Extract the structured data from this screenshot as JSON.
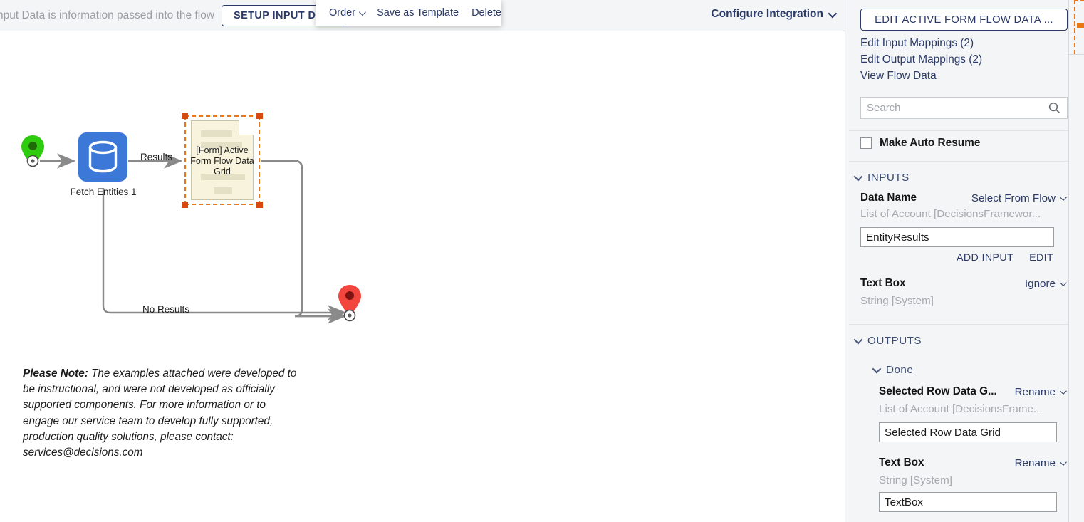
{
  "header": {
    "hint_text": "nput Data is information passed into the flow",
    "setup_input_label": "SETUP INPUT DATA",
    "configure_integration_label": "Configure Integration"
  },
  "context_menu": {
    "items": [
      {
        "label": "Order",
        "has_chevron": true
      },
      {
        "label": "Save as Template",
        "has_chevron": false
      },
      {
        "label": "Delete",
        "has_chevron": false
      }
    ]
  },
  "canvas": {
    "nodes": [
      {
        "name": "start-pin",
        "type": "start-marker",
        "color": "#2ecc0e"
      },
      {
        "name": "fetch-entities",
        "label": "Fetch Entities 1",
        "type": "database-step",
        "color": "#3c78d8"
      },
      {
        "name": "active-form-flow-data-grid",
        "label": "[Form] Active Form Flow Data Grid",
        "type": "form-step",
        "selected": true,
        "select_color": "#e8761a"
      },
      {
        "name": "end-pin",
        "type": "end-marker",
        "color": "#f1453d"
      }
    ],
    "edge_labels": [
      {
        "label": "Results"
      },
      {
        "label": "No  Results"
      }
    ],
    "note": {
      "prefix": "Please Note:",
      "body": " The examples attached were developed to be instructional, and were not developed as officially supported components. For more information or to engage our service team to develop fully supported, production quality solutions, please contact: services@decisions.com"
    }
  },
  "right_panel": {
    "edit_active_button": "EDIT ACTIVE FORM FLOW DATA ...",
    "links": [
      "Edit Input Mappings (2)",
      "Edit Output Mappings (2)",
      "View Flow Data"
    ],
    "search": {
      "value": "",
      "placeholder": "Search"
    },
    "auto_resume": {
      "label": "Make Auto Resume",
      "checked": false
    },
    "inputs": {
      "section_label": "INPUTS",
      "fields": [
        {
          "name": "Data Name",
          "action": "Select From Flow",
          "type": "List of Account [DecisionsFramewor...",
          "value": "EntityResults"
        },
        {
          "name": "Text Box",
          "action": "Ignore",
          "type": "String [System]",
          "value": null
        }
      ],
      "mini_actions": [
        "ADD INPUT",
        "EDIT"
      ]
    },
    "outputs": {
      "section_label": "OUTPUTS",
      "group_label": "Done",
      "fields": [
        {
          "name": "Selected Row Data G...",
          "action": "Rename",
          "type": "List of Account [DecisionsFrame...",
          "value": "Selected Row Data Grid"
        },
        {
          "name": "Text Box",
          "action": "Rename",
          "type": "String [System]",
          "value": "TextBox"
        }
      ]
    }
  },
  "colors": {
    "brand_navy": "#2b3a67",
    "selection_orange": "#e8761a",
    "panel_bg": "#f4f5f6",
    "db_blue": "#3c78d8"
  }
}
